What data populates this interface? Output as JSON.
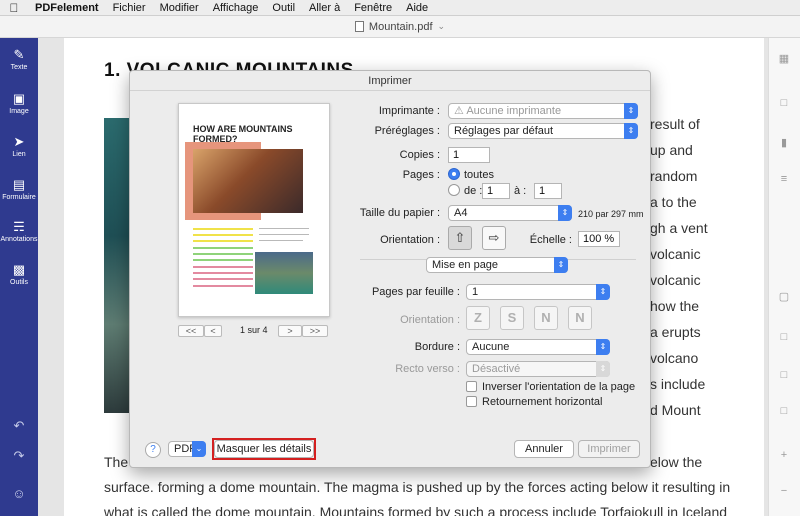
{
  "menubar": {
    "app": "PDFelement",
    "items": [
      "Fichier",
      "Modifier",
      "Affichage",
      "Outil",
      "Aller à",
      "Fenêtre",
      "Aide"
    ]
  },
  "window": {
    "title": "Mountain.pdf"
  },
  "sidebar": {
    "items": [
      {
        "label": "Texte",
        "icon": "pen-icon"
      },
      {
        "label": "Image",
        "icon": "image-icon"
      },
      {
        "label": "Lien",
        "icon": "link-icon"
      },
      {
        "label": "Formulaire",
        "icon": "form-icon"
      },
      {
        "label": "Annotations",
        "icon": "annotation-icon"
      },
      {
        "label": "Outils",
        "icon": "tools-icon"
      }
    ]
  },
  "document": {
    "title": "1. VOLCANIC MOUNTAINS",
    "right_fragments": [
      "result of",
      "up and",
      "random",
      "a to the",
      "gh a vent",
      "volcanic",
      "volcanic",
      "how the",
      "a erupts",
      "volcano",
      "s include",
      "d Mount"
    ],
    "line_start": "The",
    "line_end": "elow the",
    "line2": "surface. forming a dome mountain. The magma is pushed up by the forces acting below it resulting in",
    "line3": "what is called the dome mountain. Mountains formed by such a process include Torfajokull in Iceland"
  },
  "dialog": {
    "title": "Imprimer",
    "preview": {
      "title": "HOW ARE MOUNTAINS FORMED?",
      "page_label": "1 sur 4",
      "nav_first": "<<",
      "nav_prev": "<",
      "nav_next": ">",
      "nav_last": ">>"
    },
    "printer_label": "Imprimante :",
    "printer_value": "Aucune imprimante",
    "presets_label": "Préréglages :",
    "presets_value": "Réglages par défaut",
    "copies_label": "Copies :",
    "copies_value": "1",
    "pages_label": "Pages :",
    "pages_all": "toutes",
    "pages_from": "de :",
    "pages_from_value": "1",
    "pages_to": "à :",
    "pages_to_value": "1",
    "paper_label": "Taille du papier :",
    "paper_value": "A4",
    "paper_dims": "210 par 297 mm",
    "orientation_label": "Orientation :",
    "scale_label": "Échelle :",
    "scale_value": "100 %",
    "section_value": "Mise en page",
    "pps_label": "Pages par feuille :",
    "pps_value": "1",
    "layout_orientation_label": "Orientation :",
    "border_label": "Bordure :",
    "border_value": "Aucune",
    "duplex_label": "Recto verso :",
    "duplex_value": "Désactivé",
    "reverse_label": "Inverser l'orientation de la page",
    "flip_label": "Retournement horizontal",
    "help": "?",
    "pdf_label": "PDF",
    "hide_details": "Masquer les détails",
    "cancel": "Annuler",
    "print": "Imprimer"
  },
  "colors": {
    "accent": "#3d7ef0",
    "sidebar": "#2f3a8f",
    "highlight_box": "#d42020"
  }
}
